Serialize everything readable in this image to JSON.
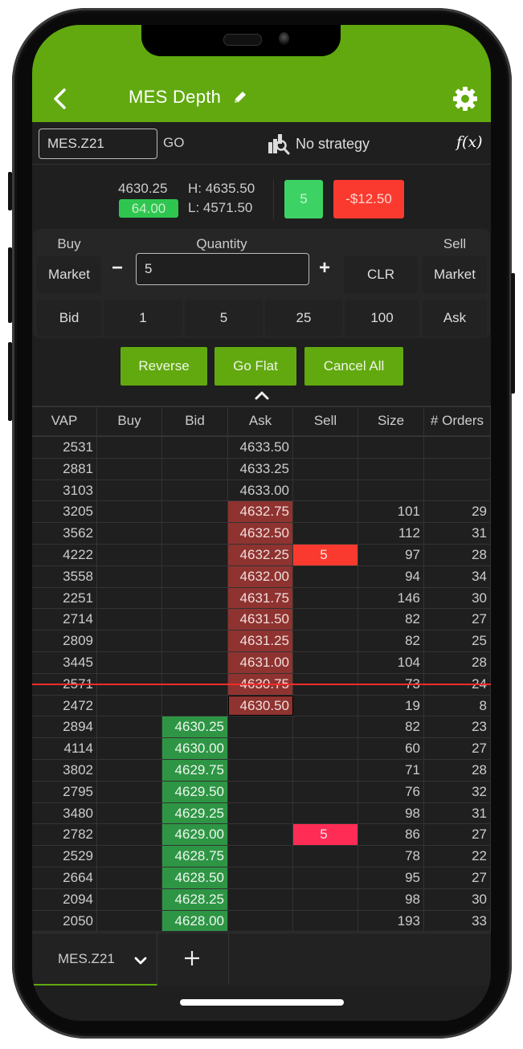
{
  "header": {
    "title": "MES Depth",
    "back_icon": "chevron-left-icon",
    "edit_icon": "pencil-icon",
    "settings_icon": "gear-icon"
  },
  "toolbar": {
    "symbol_value": "MES.Z21",
    "go_label": "GO",
    "strategy_icon": "strategy-icon",
    "strategy_label": "No strategy",
    "fx_label": "f(x)"
  },
  "quote": {
    "last": "4630.25",
    "change": "64.00",
    "high": "H: 4635.50",
    "low": "L: 4571.50",
    "position": "5",
    "pnl": "-$12.50"
  },
  "order_panel": {
    "buy_label": "Buy",
    "quantity_label": "Quantity",
    "sell_label": "Sell",
    "buy_market": "Market",
    "minus": "−",
    "quantity_value": "5",
    "plus": "+",
    "clr": "CLR",
    "sell_market": "Market",
    "bid": "Bid",
    "presets": [
      "1",
      "5",
      "25",
      "100"
    ],
    "ask": "Ask"
  },
  "actions": {
    "reverse": "Reverse",
    "go_flat": "Go Flat",
    "cancel_all": "Cancel All"
  },
  "ladder": {
    "columns": [
      "VAP",
      "Buy",
      "Bid",
      "Ask",
      "Sell",
      "Size",
      "# Orders"
    ],
    "rows": [
      {
        "vap": "2531",
        "buy": "",
        "bid": "",
        "ask": "4633.50",
        "sell": "",
        "size": "",
        "orders": "",
        "ask_hl": false,
        "bid_hl": false,
        "sell_style": ""
      },
      {
        "vap": "2881",
        "buy": "",
        "bid": "",
        "ask": "4633.25",
        "sell": "",
        "size": "",
        "orders": "",
        "ask_hl": false,
        "bid_hl": false,
        "sell_style": ""
      },
      {
        "vap": "3103",
        "buy": "",
        "bid": "",
        "ask": "4633.00",
        "sell": "",
        "size": "",
        "orders": "",
        "ask_hl": false,
        "bid_hl": false,
        "sell_style": ""
      },
      {
        "vap": "3205",
        "buy": "",
        "bid": "",
        "ask": "4632.75",
        "sell": "",
        "size": "101",
        "orders": "29",
        "ask_hl": true,
        "bid_hl": false,
        "sell_style": ""
      },
      {
        "vap": "3562",
        "buy": "",
        "bid": "",
        "ask": "4632.50",
        "sell": "",
        "size": "112",
        "orders": "31",
        "ask_hl": true,
        "bid_hl": false,
        "sell_style": ""
      },
      {
        "vap": "4222",
        "buy": "",
        "bid": "",
        "ask": "4632.25",
        "sell": "5",
        "size": "97",
        "orders": "28",
        "ask_hl": true,
        "bid_hl": false,
        "sell_style": "red"
      },
      {
        "vap": "3558",
        "buy": "",
        "bid": "",
        "ask": "4632.00",
        "sell": "",
        "size": "94",
        "orders": "34",
        "ask_hl": true,
        "bid_hl": false,
        "sell_style": ""
      },
      {
        "vap": "2251",
        "buy": "",
        "bid": "",
        "ask": "4631.75",
        "sell": "",
        "size": "146",
        "orders": "30",
        "ask_hl": true,
        "bid_hl": false,
        "sell_style": ""
      },
      {
        "vap": "2714",
        "buy": "",
        "bid": "",
        "ask": "4631.50",
        "sell": "",
        "size": "82",
        "orders": "27",
        "ask_hl": true,
        "bid_hl": false,
        "sell_style": ""
      },
      {
        "vap": "2809",
        "buy": "",
        "bid": "",
        "ask": "4631.25",
        "sell": "",
        "size": "82",
        "orders": "25",
        "ask_hl": true,
        "bid_hl": false,
        "sell_style": ""
      },
      {
        "vap": "3445",
        "buy": "",
        "bid": "",
        "ask": "4631.00",
        "sell": "",
        "size": "104",
        "orders": "28",
        "ask_hl": true,
        "bid_hl": false,
        "sell_style": ""
      },
      {
        "vap": "2571",
        "buy": "",
        "bid": "",
        "ask": "4630.75",
        "sell": "",
        "size": "73",
        "orders": "24",
        "ask_hl": true,
        "bid_hl": false,
        "sell_style": ""
      },
      {
        "vap": "2472",
        "buy": "",
        "bid": "",
        "ask": "4630.50",
        "sell": "",
        "size": "19",
        "orders": "8",
        "ask_hl": "best",
        "bid_hl": false,
        "sell_style": ""
      },
      {
        "vap": "2894",
        "buy": "",
        "bid": "4630.25",
        "ask": "",
        "sell": "",
        "size": "82",
        "orders": "23",
        "ask_hl": false,
        "bid_hl": true,
        "sell_style": ""
      },
      {
        "vap": "4114",
        "buy": "",
        "bid": "4630.00",
        "ask": "",
        "sell": "",
        "size": "60",
        "orders": "27",
        "ask_hl": false,
        "bid_hl": true,
        "sell_style": ""
      },
      {
        "vap": "3802",
        "buy": "",
        "bid": "4629.75",
        "ask": "",
        "sell": "",
        "size": "71",
        "orders": "28",
        "ask_hl": false,
        "bid_hl": true,
        "sell_style": ""
      },
      {
        "vap": "2795",
        "buy": "",
        "bid": "4629.50",
        "ask": "",
        "sell": "",
        "size": "76",
        "orders": "32",
        "ask_hl": false,
        "bid_hl": true,
        "sell_style": ""
      },
      {
        "vap": "3480",
        "buy": "",
        "bid": "4629.25",
        "ask": "",
        "sell": "",
        "size": "98",
        "orders": "31",
        "ask_hl": false,
        "bid_hl": true,
        "sell_style": ""
      },
      {
        "vap": "2782",
        "buy": "",
        "bid": "4629.00",
        "ask": "",
        "sell": "5",
        "size": "86",
        "orders": "27",
        "ask_hl": false,
        "bid_hl": true,
        "sell_style": "pink"
      },
      {
        "vap": "2529",
        "buy": "",
        "bid": "4628.75",
        "ask": "",
        "sell": "",
        "size": "78",
        "orders": "22",
        "ask_hl": false,
        "bid_hl": true,
        "sell_style": ""
      },
      {
        "vap": "2664",
        "buy": "",
        "bid": "4628.50",
        "ask": "",
        "sell": "",
        "size": "95",
        "orders": "27",
        "ask_hl": false,
        "bid_hl": true,
        "sell_style": ""
      },
      {
        "vap": "2094",
        "buy": "",
        "bid": "4628.25",
        "ask": "",
        "sell": "",
        "size": "98",
        "orders": "30",
        "ask_hl": false,
        "bid_hl": true,
        "sell_style": ""
      },
      {
        "vap": "2050",
        "buy": "",
        "bid": "4628.00",
        "ask": "",
        "sell": "",
        "size": "193",
        "orders": "33",
        "ask_hl": false,
        "bid_hl": true,
        "sell_style": ""
      }
    ],
    "last_trade_row_index": 11
  },
  "tabs": {
    "items": [
      {
        "label": "MES.Z21",
        "active": true
      }
    ],
    "add_icon": "plus-icon",
    "dropdown_icon": "chevron-down-icon"
  },
  "colors": {
    "brand_green": "#61a90f",
    "ask_bg": "#8e3330",
    "bid_bg": "#2e9544",
    "sell_order_red": "#fb3a2f",
    "sell_order_pink": "#ff2c55",
    "position_green": "#3dd364",
    "last_trade_line": "#f52b2b"
  }
}
